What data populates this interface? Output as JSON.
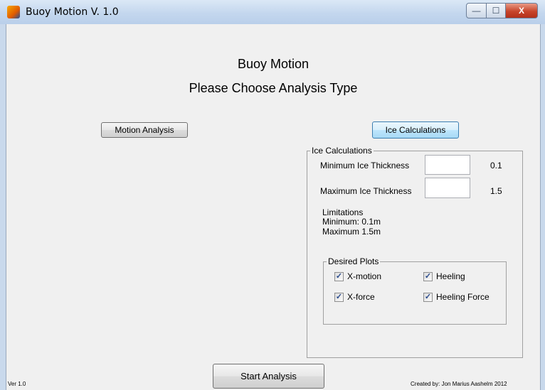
{
  "window": {
    "title": "Buoy Motion V. 1.0",
    "controls": {
      "minimize": "—",
      "maximize": "☐",
      "close": "X"
    }
  },
  "header": {
    "title": "Buoy Motion",
    "subtitle": "Please Choose Analysis Type"
  },
  "buttons": {
    "motion_analysis": "Motion Analysis",
    "ice_calculations": "Ice Calculations",
    "start_analysis": "Start Analysis"
  },
  "ice_panel": {
    "title": "Ice Calculations",
    "min_label": "Minimum Ice Thickness",
    "min_value": "",
    "min_hint": "0.1",
    "max_label": "Maximum Ice Thickness",
    "max_value": "",
    "max_hint": "1.5",
    "limitations": {
      "title": "Limitations",
      "min": "Minimum: 0.1m",
      "max": "Maximum 1.5m"
    }
  },
  "plots_panel": {
    "title": "Desired Plots",
    "checkboxes": [
      {
        "label": "X-motion",
        "checked": true
      },
      {
        "label": "Heeling",
        "checked": true
      },
      {
        "label": "X-force",
        "checked": true
      },
      {
        "label": "Heeling Force",
        "checked": true
      }
    ],
    "check_mark": "✓"
  },
  "footer": {
    "version": "Ver 1.0",
    "credit": "Created by: Jon Marius Aashelm 2012"
  },
  "colors": {
    "titlebar": "#c4d7ee",
    "client": "#f0f0f0",
    "active_button": "#bee6fd",
    "close": "#c7452b"
  }
}
